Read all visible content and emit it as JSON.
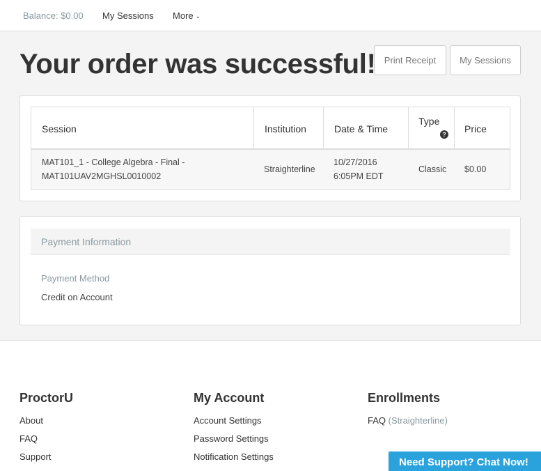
{
  "nav": {
    "balance": "Balance: $0.00",
    "my_sessions": "My Sessions",
    "more": "More"
  },
  "page": {
    "title": "Your order was successful!",
    "print_receipt": "Print Receipt",
    "my_sessions_button": "My Sessions"
  },
  "order_table": {
    "headers": [
      "Session",
      "Institution",
      "Date & Time",
      "Type",
      "Price"
    ],
    "rows": [
      {
        "session_line1": "MAT101_1 - College Algebra - Final -",
        "session_line2": "MAT101UAV2MGHSL0010002",
        "institution": "Straighterline",
        "date_line1": "10/27/2016",
        "date_line2": "6:05PM EDT",
        "type": "Classic",
        "price": "$0.00"
      }
    ]
  },
  "payment": {
    "header": "Payment Information",
    "method_label": "Payment Method",
    "method_value": "Credit on Account"
  },
  "footer": {
    "proctoru": {
      "title": "ProctorU",
      "links": [
        "About",
        "FAQ",
        "Support"
      ]
    },
    "my_account": {
      "title": "My Account",
      "links": [
        "Account Settings",
        "Password Settings",
        "Notification Settings"
      ]
    },
    "enrollments": {
      "title": "Enrollments",
      "faq_label": "FAQ",
      "faq_suffix": "(Straighterline)"
    }
  },
  "chat": {
    "label": "Need Support? Chat Now!"
  }
}
